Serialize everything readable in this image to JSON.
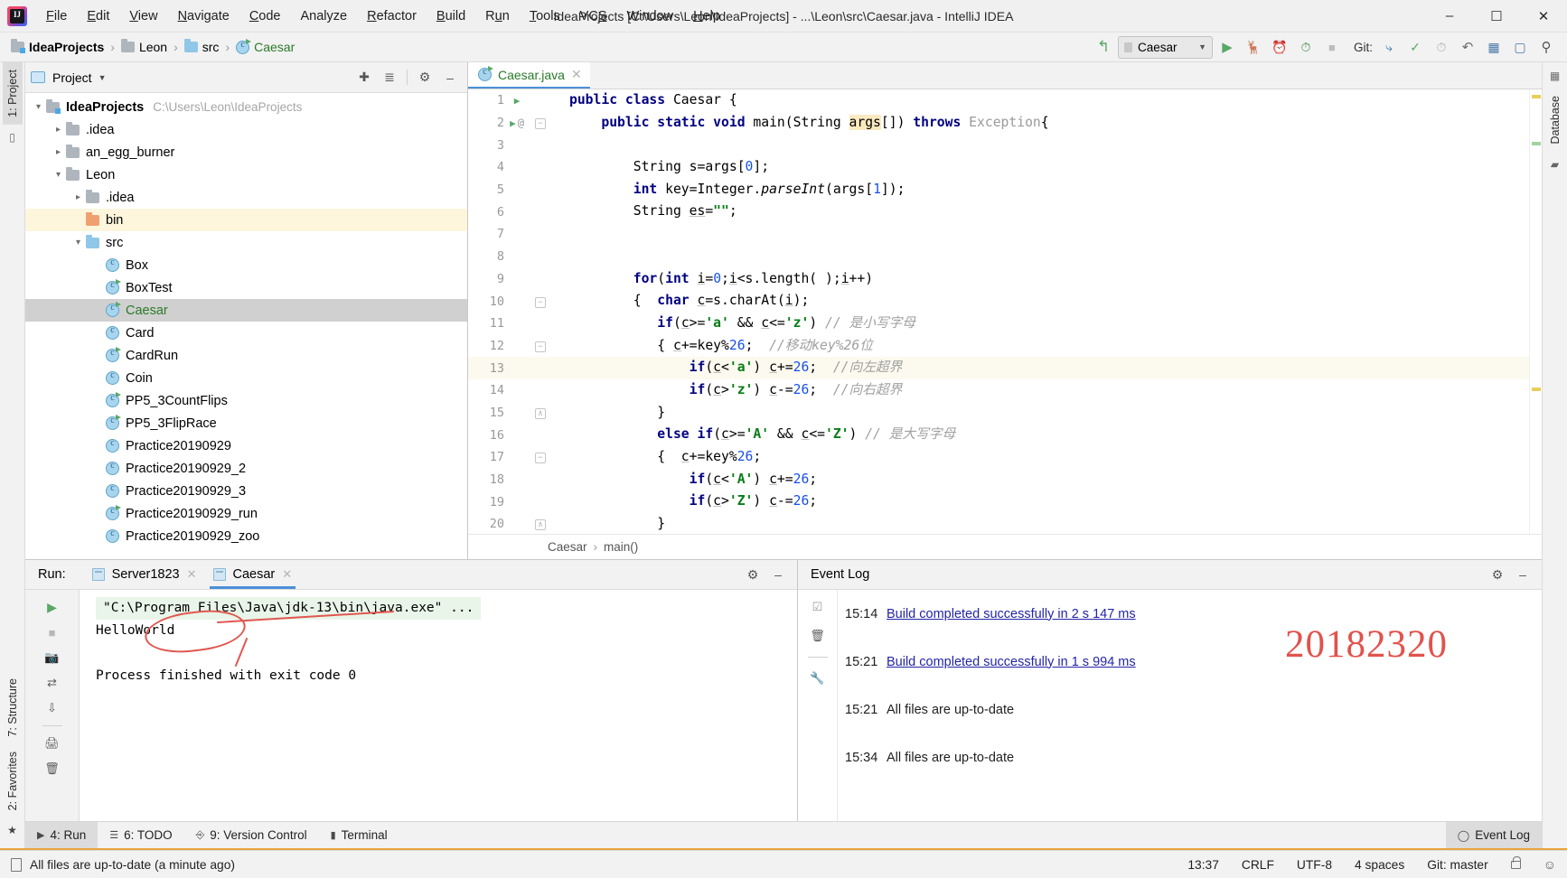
{
  "titlebar": {
    "window_title": "IdeaProjects [C:\\Users\\Leon\\IdeaProjects] - ...\\Leon\\src\\Caesar.java - IntelliJ IDEA",
    "menus": [
      "File",
      "Edit",
      "View",
      "Navigate",
      "Code",
      "Analyze",
      "Refactor",
      "Build",
      "Run",
      "Tools",
      "VCS",
      "Window",
      "Help"
    ],
    "minimize": "–",
    "maximize": "☐",
    "close": "✕"
  },
  "toolbar": {
    "breadcrumbs": [
      "IdeaProjects",
      "Leon",
      "src",
      "Caesar"
    ],
    "run_config": "Caesar",
    "git_label": "Git:",
    "icons": [
      "back-arrow-icon",
      "run-icon",
      "debug-icon",
      "run-coverage-icon",
      "profiler-icon",
      "stop-icon",
      "update-project-icon",
      "commit-icon",
      "history-icon",
      "rollback-icon",
      "project-structure-icon",
      "preview-icon",
      "search-everywhere-icon"
    ]
  },
  "left_strip": {
    "project_tab": "1: Project",
    "structure_tab": "7: Structure",
    "favorites_tab": "2: Favorites"
  },
  "right_strip": {
    "database_tab": "Database"
  },
  "project_panel": {
    "title": "Project",
    "tree": [
      {
        "depth": 0,
        "arrow": "down",
        "icon": "project-folder-icon",
        "label": "IdeaProjects",
        "bold": true,
        "path": "C:\\Users\\Leon\\IdeaProjects"
      },
      {
        "depth": 1,
        "arrow": "right",
        "icon": "folder-icon",
        "label": ".idea"
      },
      {
        "depth": 1,
        "arrow": "right",
        "icon": "folder-icon",
        "label": "an_egg_burner"
      },
      {
        "depth": 1,
        "arrow": "down",
        "icon": "folder-icon",
        "label": "Leon"
      },
      {
        "depth": 2,
        "arrow": "right",
        "icon": "folder-icon",
        "label": ".idea"
      },
      {
        "depth": 2,
        "arrow": "none",
        "icon": "folder-orange-icon",
        "label": "bin",
        "highlight": true
      },
      {
        "depth": 2,
        "arrow": "down",
        "icon": "folder-blue-icon",
        "label": "src"
      },
      {
        "depth": 3,
        "arrow": "none",
        "icon": "class-icon",
        "label": "Box"
      },
      {
        "depth": 3,
        "arrow": "none",
        "icon": "class-runnable-icon",
        "label": "BoxTest"
      },
      {
        "depth": 3,
        "arrow": "none",
        "icon": "class-runnable-icon",
        "label": "Caesar",
        "selected": true,
        "green": true
      },
      {
        "depth": 3,
        "arrow": "none",
        "icon": "class-icon",
        "label": "Card"
      },
      {
        "depth": 3,
        "arrow": "none",
        "icon": "class-runnable-icon",
        "label": "CardRun"
      },
      {
        "depth": 3,
        "arrow": "none",
        "icon": "class-icon",
        "label": "Coin"
      },
      {
        "depth": 3,
        "arrow": "none",
        "icon": "class-runnable-icon",
        "label": "PP5_3CountFlips"
      },
      {
        "depth": 3,
        "arrow": "none",
        "icon": "class-runnable-icon",
        "label": "PP5_3FlipRace"
      },
      {
        "depth": 3,
        "arrow": "none",
        "icon": "class-icon",
        "label": "Practice20190929"
      },
      {
        "depth": 3,
        "arrow": "none",
        "icon": "class-icon",
        "label": "Practice20190929_2"
      },
      {
        "depth": 3,
        "arrow": "none",
        "icon": "class-icon",
        "label": "Practice20190929_3"
      },
      {
        "depth": 3,
        "arrow": "none",
        "icon": "class-runnable-icon",
        "label": "Practice20190929_run"
      },
      {
        "depth": 3,
        "arrow": "none",
        "icon": "class-icon",
        "label": "Practice20190929_zoo"
      }
    ]
  },
  "editor": {
    "tab": {
      "label": "Caesar.java",
      "close": "✕"
    },
    "breadcrumb": {
      "class": "Caesar",
      "method": "main()",
      "separator": "›"
    },
    "current_line": 13,
    "lines": [
      {
        "n": 1,
        "gutter_icon": "run-gutter-icon",
        "fold": "",
        "html": "<span class=\"kw\">public class</span> Caesar {"
      },
      {
        "n": 2,
        "gutter_icon": "run-gutter-icon-at",
        "fold": "-",
        "html": "    <span class=\"kw\">public static void</span> main(String <span class=\"hlw\">args</span>[]) <span class=\"kw\">throws</span> <span class=\"grayed\">Exception</span>{"
      },
      {
        "n": 3,
        "gutter_icon": "",
        "fold": "",
        "html": ""
      },
      {
        "n": 4,
        "gutter_icon": "",
        "fold": "",
        "html": "        String s=args[<span class=\"num\">0</span>];"
      },
      {
        "n": 5,
        "gutter_icon": "",
        "fold": "",
        "html": "        <span class=\"kw\">int</span> key=Integer.<span class=\"ital\">parseInt</span>(args[<span class=\"num\">1</span>]);"
      },
      {
        "n": 6,
        "gutter_icon": "",
        "fold": "",
        "html": "        String <span class=\"und\">es</span>=<span class=\"str\">\"\"</span>;"
      },
      {
        "n": 7,
        "gutter_icon": "",
        "fold": "",
        "html": ""
      },
      {
        "n": 8,
        "gutter_icon": "",
        "fold": "",
        "html": ""
      },
      {
        "n": 9,
        "gutter_icon": "",
        "fold": "",
        "html": "        <span class=\"kw\">for</span>(<span class=\"kw\">int</span> <span class=\"und\">i</span>=<span class=\"num\">0</span>;<span class=\"und\">i</span>&lt;s.length( );<span class=\"und\">i</span>++)"
      },
      {
        "n": 10,
        "gutter_icon": "",
        "fold": "-",
        "html": "        {  <span class=\"kw\">char</span> <span class=\"und\">c</span>=s.charAt(<span class=\"und\">i</span>);"
      },
      {
        "n": 11,
        "gutter_icon": "",
        "fold": "",
        "html": "           <span class=\"kw\">if</span>(<span class=\"und\">c</span>&gt;=<span class=\"str\">'a'</span> &amp;&amp; <span class=\"und\">c</span>&lt;=<span class=\"str\">'z'</span>) <span class=\"cmt\">// 是小写字母</span>"
      },
      {
        "n": 12,
        "gutter_icon": "",
        "fold": "-",
        "html": "           { <span class=\"und\">c</span>+=key%<span class=\"num\">26</span>;  <span class=\"cmt\">//移动key%26位</span>"
      },
      {
        "n": 13,
        "gutter_icon": "",
        "fold": "",
        "html": "               <span class=\"kw\">if</span>(<span class=\"und\">c</span>&lt;<span class=\"str\">'a'</span>) <span class=\"und\">c</span>+=<span class=\"num\">26</span>;  <span class=\"cmt\">//向左超界</span>"
      },
      {
        "n": 14,
        "gutter_icon": "",
        "fold": "",
        "html": "               <span class=\"kw\">if</span>(<span class=\"und\">c</span>&gt;<span class=\"str\">'z'</span>) <span class=\"und\">c</span>-=<span class=\"num\">26</span>;  <span class=\"cmt\">//向右超界</span>"
      },
      {
        "n": 15,
        "gutter_icon": "",
        "fold": "+",
        "html": "           }"
      },
      {
        "n": 16,
        "gutter_icon": "",
        "fold": "",
        "html": "           <span class=\"kw\">else if</span>(<span class=\"und\">c</span>&gt;=<span class=\"str\">'A'</span> &amp;&amp; <span class=\"und\">c</span>&lt;=<span class=\"str\">'Z'</span>) <span class=\"cmt\">// 是大写字母</span>"
      },
      {
        "n": 17,
        "gutter_icon": "",
        "fold": "-",
        "html": "           {  <span class=\"und\">c</span>+=key%<span class=\"num\">26</span>;"
      },
      {
        "n": 18,
        "gutter_icon": "",
        "fold": "",
        "html": "               <span class=\"kw\">if</span>(<span class=\"und\">c</span>&lt;<span class=\"str\">'A'</span>) <span class=\"und\">c</span>+=<span class=\"num\">26</span>;"
      },
      {
        "n": 19,
        "gutter_icon": "",
        "fold": "",
        "html": "               <span class=\"kw\">if</span>(<span class=\"und\">c</span>&gt;<span class=\"str\">'Z'</span>) <span class=\"und\">c</span>-=<span class=\"num\">26</span>;"
      },
      {
        "n": 20,
        "gutter_icon": "",
        "fold": "+",
        "html": "           }"
      }
    ]
  },
  "run_panel": {
    "label": "Run:",
    "tabs": [
      {
        "label": "Server1823",
        "active": false,
        "close": "✕"
      },
      {
        "label": "Caesar",
        "active": true,
        "close": "✕"
      }
    ],
    "console": [
      "\"C:\\Program Files\\Java\\jdk-13\\bin\\java.exe\" ...",
      "HelloWorld",
      "",
      "Process finished with exit code 0"
    ],
    "annotation": "red-ellipse-around-helloworld"
  },
  "event_log": {
    "title": "Event Log",
    "entries": [
      {
        "time": "15:14",
        "text": "Build completed successfully in 2 s 147 ms",
        "link": true
      },
      {
        "time": "15:21",
        "text": "Build completed successfully in 1 s 994 ms",
        "link": true
      },
      {
        "time": "15:21",
        "text": "All files are up-to-date",
        "link": false
      },
      {
        "time": "15:34",
        "text": "All files are up-to-date",
        "link": false
      }
    ],
    "annotation_number": "20182320",
    "annotation_color": "#e2524c"
  },
  "toolwindow_bar": {
    "items": [
      {
        "label": "4: Run",
        "icon": "run-icon",
        "active": true
      },
      {
        "label": "6: TODO",
        "icon": "todo-icon",
        "active": false
      },
      {
        "label": "9: Version Control",
        "icon": "vcs-icon",
        "active": false
      },
      {
        "label": "Terminal",
        "icon": "terminal-icon",
        "active": false
      }
    ],
    "right_item": {
      "label": "Event Log",
      "icon": "event-log-icon"
    }
  },
  "statusbar": {
    "message": "All files are up-to-date (a minute ago)",
    "caret": "13:37",
    "line_separator": "CRLF",
    "encoding": "UTF-8",
    "indent": "4 spaces",
    "branch": "Git: master"
  }
}
